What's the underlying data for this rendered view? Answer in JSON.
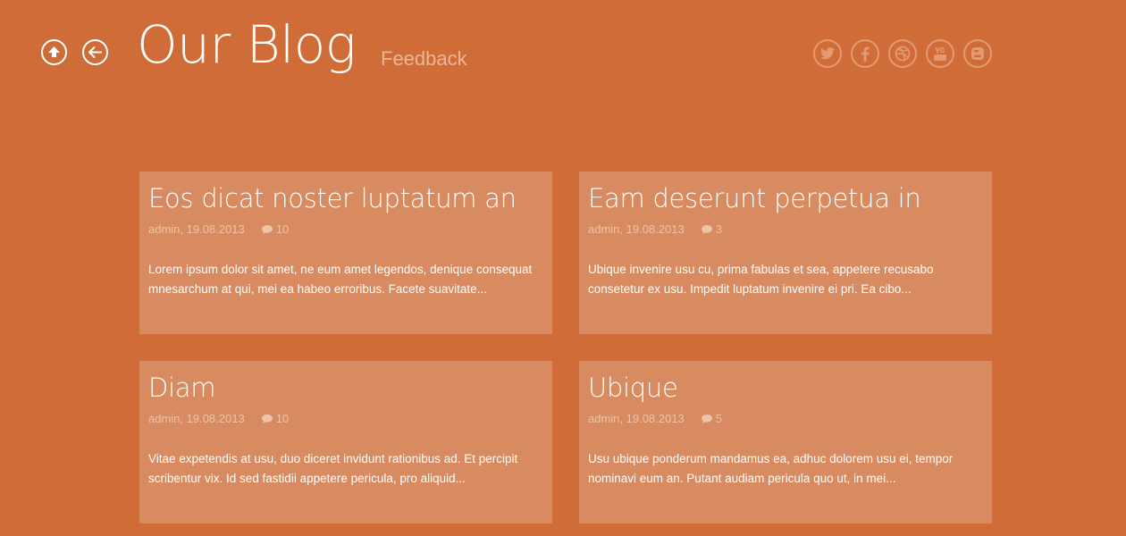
{
  "header": {
    "title": "Our Blog",
    "feedback_label": "Feedback",
    "social_icons": [
      "twitter-icon",
      "facebook-icon",
      "dribbble-icon",
      "youtube-icon",
      "blogger-icon"
    ]
  },
  "colors": {
    "background": "#cf6c38",
    "card": "#d88a60",
    "accent_light": "#efb594"
  },
  "posts": [
    {
      "title": "Eos dicat noster luptatum an",
      "author_date": "admin, 19.08.2013",
      "comments": "10",
      "excerpt": "Lorem ipsum dolor sit amet, ne eum amet legendos, denique consequat mnesarchum at qui, mei ea habeo erroribus. Facete suavitate..."
    },
    {
      "title": "Eam deserunt perpetua in",
      "author_date": "admin, 19.08.2013",
      "comments": "3",
      "excerpt": "Ubique invenire usu cu, prima fabulas et sea, appetere recusabo consetetur ex usu. Impedit luptatum invenire ei pri. Ea cibo..."
    },
    {
      "title": "Diam",
      "author_date": "admin, 19.08.2013",
      "comments": "10",
      "excerpt": "Vitae expetendis at usu, duo diceret invidunt rationibus ad. Et percipit scribentur vix. Id sed fastidii appetere pericula, pro aliquid..."
    },
    {
      "title": "Ubique",
      "author_date": "admin, 19.08.2013",
      "comments": "5",
      "excerpt": "Usu ubique ponderum mandamus ea, adhuc dolorem usu ei, tempor nominavi eum an. Putant audiam pericula quo ut, in mei..."
    }
  ]
}
